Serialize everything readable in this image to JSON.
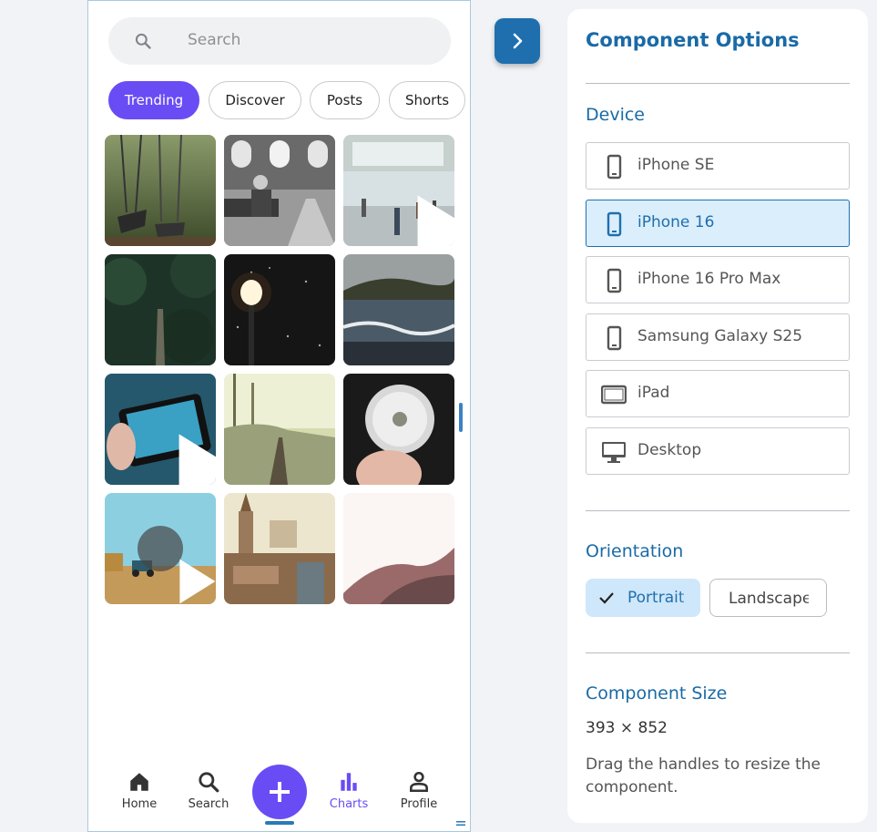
{
  "phone": {
    "search_placeholder": "Search",
    "chips": [
      {
        "label": "Trending",
        "active": true
      },
      {
        "label": "Discover",
        "active": false
      },
      {
        "label": "Posts",
        "active": false
      },
      {
        "label": "Shorts",
        "active": false
      }
    ],
    "tiles": [
      {
        "name": "tile-swings",
        "video": false
      },
      {
        "name": "tile-church-man",
        "video": false
      },
      {
        "name": "tile-station-crowd",
        "video": true
      },
      {
        "name": "tile-forest-path",
        "video": false
      },
      {
        "name": "tile-night-lamp",
        "video": false
      },
      {
        "name": "tile-sea-waves",
        "video": false
      },
      {
        "name": "tile-phone-photo",
        "video": true
      },
      {
        "name": "tile-railway",
        "video": false
      },
      {
        "name": "tile-dandelion",
        "video": false
      },
      {
        "name": "tile-tractor-field",
        "video": true
      },
      {
        "name": "tile-town",
        "video": false
      },
      {
        "name": "tile-hills",
        "video": false
      }
    ],
    "nav": {
      "home": "Home",
      "search": "Search",
      "charts": "Charts",
      "profile": "Profile"
    },
    "active_nav": "Charts"
  },
  "panel": {
    "title": "Component Options",
    "device_title": "Device",
    "devices": [
      {
        "label": "iPhone SE",
        "icon": "phone-icon",
        "selected": false
      },
      {
        "label": "iPhone 16",
        "icon": "phone-icon",
        "selected": true
      },
      {
        "label": "iPhone 16 Pro Max",
        "icon": "phone-icon",
        "selected": false
      },
      {
        "label": "Samsung Galaxy S25",
        "icon": "phone-icon",
        "selected": false
      },
      {
        "label": "iPad",
        "icon": "tablet-icon",
        "selected": false
      },
      {
        "label": "Desktop",
        "icon": "desktop-icon",
        "selected": false
      }
    ],
    "orientation_title": "Orientation",
    "orientation": {
      "portrait": "Portrait",
      "landscape": "Landscape",
      "selected": "Portrait"
    },
    "size_title": "Component Size",
    "size_value": "393 × 852",
    "help": "Drag the handles to resize the component."
  },
  "colors": {
    "accent": "#6a4cf5",
    "primary": "#1f6fae",
    "selected_bg": "#dbeefb"
  }
}
